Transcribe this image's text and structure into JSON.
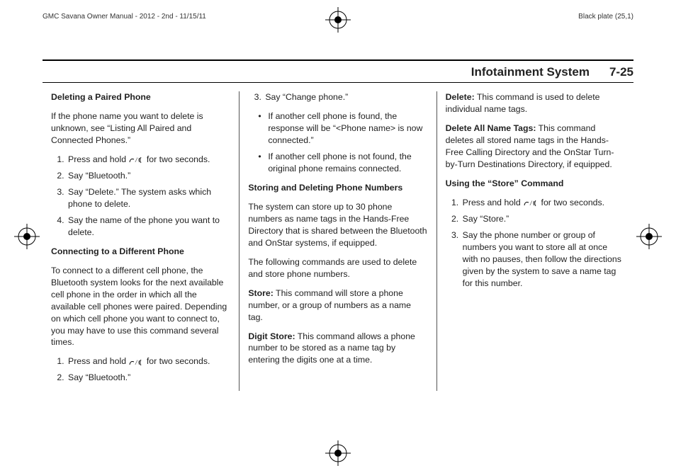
{
  "meta": {
    "left_header": "GMC Savana Owner Manual - 2012 - 2nd - 11/15/11",
    "right_header": "Black plate (25,1)"
  },
  "running": {
    "section": "Infotainment System",
    "page": "7-25"
  },
  "col1": {
    "h1": "Deleting a Paired Phone",
    "p1": "If the phone name you want to delete is unknown, see “Listing All Paired and Connected Phones.”",
    "s1_pre": "Press and hold ",
    "s1_post": " for two seconds.",
    "s2": "Say “Bluetooth.”",
    "s3": "Say “Delete.” The system asks which phone to delete.",
    "s4": "Say the name of the phone you want to delete.",
    "h2": "Connecting to a Different Phone",
    "p2": "To connect to a different cell phone, the Bluetooth system looks for the next available cell phone in the order in which all the available cell phones were paired. Depending on which cell phone you want to connect to, you may have to use this command several times.",
    "s5_pre": "Press and hold ",
    "s5_post": " for two seconds.",
    "s6": "Say “Bluetooth.”"
  },
  "col2": {
    "s1": "Say “Change phone.”",
    "b1": "If another cell phone is found, the response will be “<Phone name> is now connected.”",
    "b2": "If another cell phone is not found, the original phone remains connected.",
    "h1": "Storing and Deleting Phone Numbers",
    "p1": "The system can store up to 30 phone numbers as name tags in the Hands-Free Directory that is shared between the Bluetooth and OnStar systems, if equipped.",
    "p2": "The following commands are used to delete and store phone numbers.",
    "t1_label": "Store:",
    "t1_text": "  This command will store a phone number, or a group of numbers as a name tag.",
    "t2_label": "Digit Store:",
    "t2_text": "  This command allows a phone number to be stored as a name tag by entering the digits one at a time."
  },
  "col3": {
    "t1_label": "Delete:",
    "t1_text": "  This command is used to delete individual name tags.",
    "t2_label": "Delete All Name Tags:",
    "t2_text": "  This command deletes all stored name tags in the Hands-Free Calling Directory and the OnStar Turn-by-Turn Destinations Directory, if equipped.",
    "h1": "Using the “Store” Command",
    "s1_pre": "Press and hold ",
    "s1_post": " for two seconds.",
    "s2": "Say “Store.”",
    "s3": "Say the phone number or group of numbers you want to store all at once with no pauses, then follow the directions given by the system to save a name tag for this number."
  },
  "icons": {
    "phone_voice": "☎ / ☆"
  }
}
